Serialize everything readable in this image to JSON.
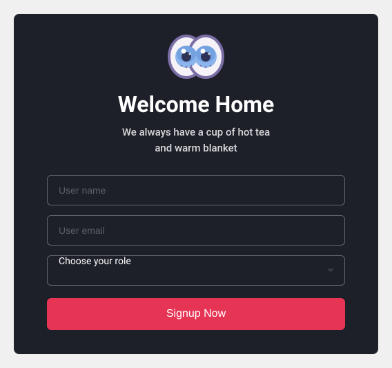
{
  "header": {
    "title": "Welcome Home",
    "subtitle_line1": "We always have a cup of hot tea",
    "subtitle_line2": "and warm blanket"
  },
  "form": {
    "username_placeholder": "User name",
    "email_placeholder": "User email",
    "role_display": "Choose your role",
    "submit_label": "Signup Now"
  },
  "logo": {
    "name": "eyes-logo",
    "outline_color": "#7b6da5",
    "fill_color": "#f5f3f7",
    "iris_color": "#8bb5ec",
    "iris_highlight": "#5e8fd6",
    "pupil_color": "#2f3357"
  }
}
